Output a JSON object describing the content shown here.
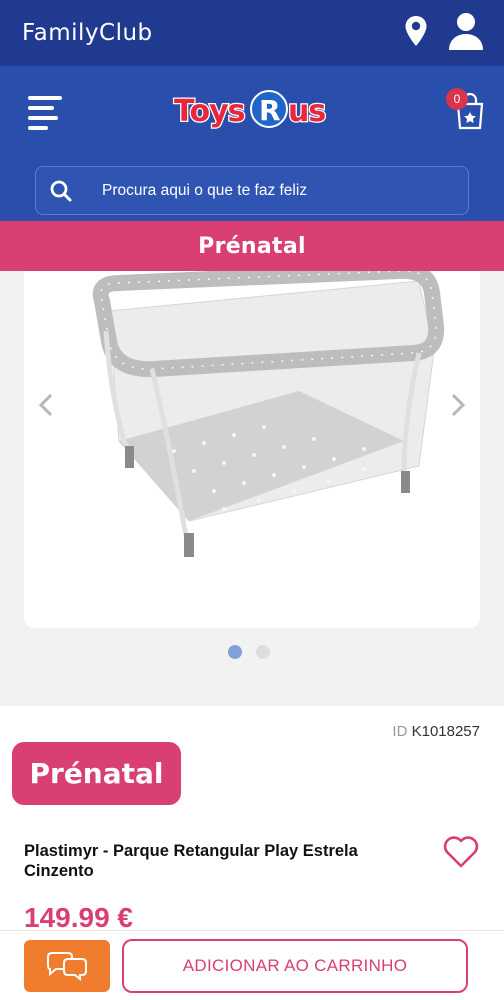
{
  "topbar": {
    "brand": "FamilyClub",
    "icons": [
      "location-pin-icon",
      "user-icon"
    ]
  },
  "header": {
    "logo_text": "ToysRus",
    "cart_count": "0",
    "search_placeholder": "Procura aqui o que te faz feliz"
  },
  "brand_bar": {
    "label": "Prénatal"
  },
  "gallery": {
    "slide_count": 2,
    "active_slide": 1
  },
  "product": {
    "id_label": "ID",
    "id_value": "K1018257",
    "brand": "Prénatal",
    "name": "Plastimyr - Parque Retangular Play Estrela Cinzento",
    "price": "149.99 €"
  },
  "actions": {
    "add_to_cart": "ADICIONAR AO CARRINHO"
  },
  "colors": {
    "top_bar": "#203a8f",
    "header": "#2a4eab",
    "brand_pink": "#d93f70",
    "chat_orange": "#f07d2e"
  }
}
